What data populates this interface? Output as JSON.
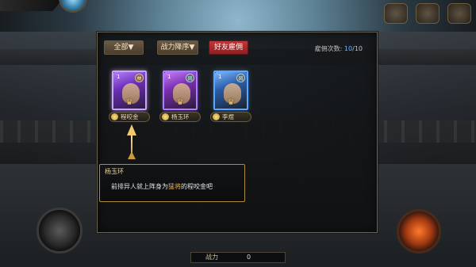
{
  "filters": {
    "all_label": "全部▼",
    "power_sort_label": "战力降序▼",
    "friend_hire_label": "好友雇佣"
  },
  "hire_count": {
    "label": "雇佣次数:",
    "current": "10",
    "separator": "/",
    "total": "10"
  },
  "heroes": [
    {
      "level": "1",
      "badge": "林",
      "name": "程咬金"
    },
    {
      "level": "1",
      "badge": "凤",
      "name": "杨玉环"
    },
    {
      "level": "1",
      "badge": "凤",
      "name": "李煜"
    }
  ],
  "dialog": {
    "speaker": "杨玉环",
    "text_before": "前排异人就上阵身为",
    "highlight": "猛将",
    "text_after": "的程咬金吧"
  },
  "power": {
    "label": "战力",
    "value": "0"
  },
  "colors": {
    "accent_gold": "#f2d88a",
    "highlight_orange": "#f1b24a",
    "count_blue": "#6db5ff",
    "hire_button_red": "#c1363a"
  },
  "icons": [
    "avatar-icon",
    "menu-icon",
    "settings-icon",
    "chat-icon",
    "crown-icon",
    "arrow-icon"
  ]
}
